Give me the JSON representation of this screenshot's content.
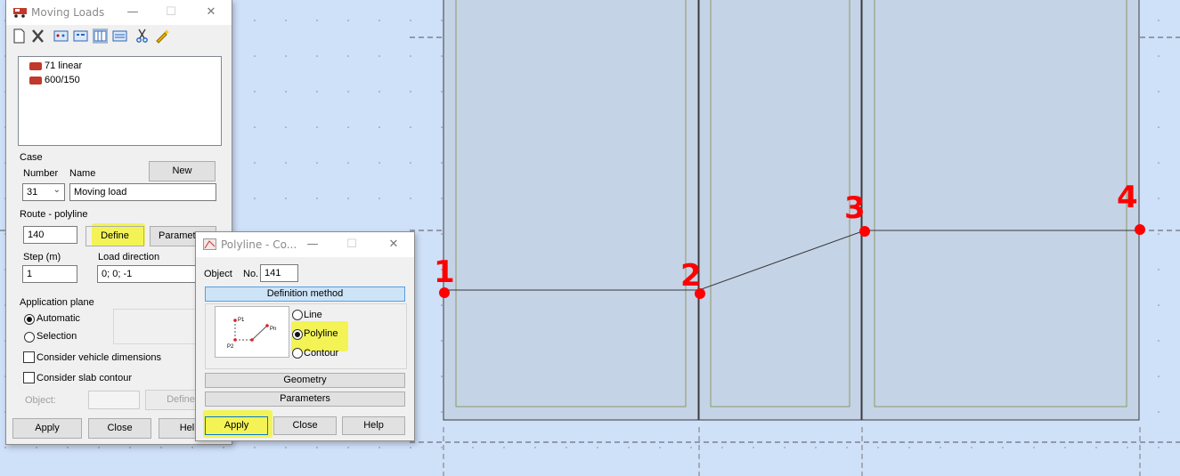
{
  "moving_loads": {
    "title": "Moving Loads",
    "list_items": [
      "71 linear",
      "600/150"
    ],
    "case": {
      "group": "Case",
      "number_label": "Number",
      "name_label": "Name",
      "new_button": "New",
      "number_value": "31",
      "name_value": "Moving load"
    },
    "route": {
      "group": "Route - polyline",
      "value": "140",
      "define_button": "Define",
      "parameters_button": "Paramete"
    },
    "step_label": "Step (m)",
    "step_value": "1",
    "load_direction_label": "Load direction",
    "load_direction_value": "0; 0; -1",
    "application_plane": {
      "group": "Application plane",
      "automatic": "Automatic",
      "selection": "Selection",
      "selected": "Automatic"
    },
    "consider_vehicle": "Consider vehicle dimensions",
    "consider_slab": "Consider slab contour",
    "object_label": "Object:",
    "object_define": "Define",
    "apply_button": "Apply",
    "close_button": "Close",
    "help_button": "Help"
  },
  "polyline_dialog": {
    "title": "Polyline - Co...",
    "object_label": "Object",
    "no_label": "No.",
    "no_value": "141",
    "definition_method": "Definition method",
    "options": [
      "Line",
      "Polyline",
      "Contour"
    ],
    "selected": "Polyline",
    "diagram_labels": [
      "P1",
      "P2",
      "Pn"
    ],
    "geometry_button": "Geometry",
    "parameters_button": "Parameters",
    "apply_button": "Apply",
    "close_button": "Close",
    "help_button": "Help"
  },
  "annotations": [
    "1",
    "2",
    "3",
    "4"
  ],
  "colors": {
    "background": "#cfe0f9",
    "slab_fill": "#c5d3e7",
    "highlight": "#f3f33b",
    "marker": "#ff0000"
  }
}
